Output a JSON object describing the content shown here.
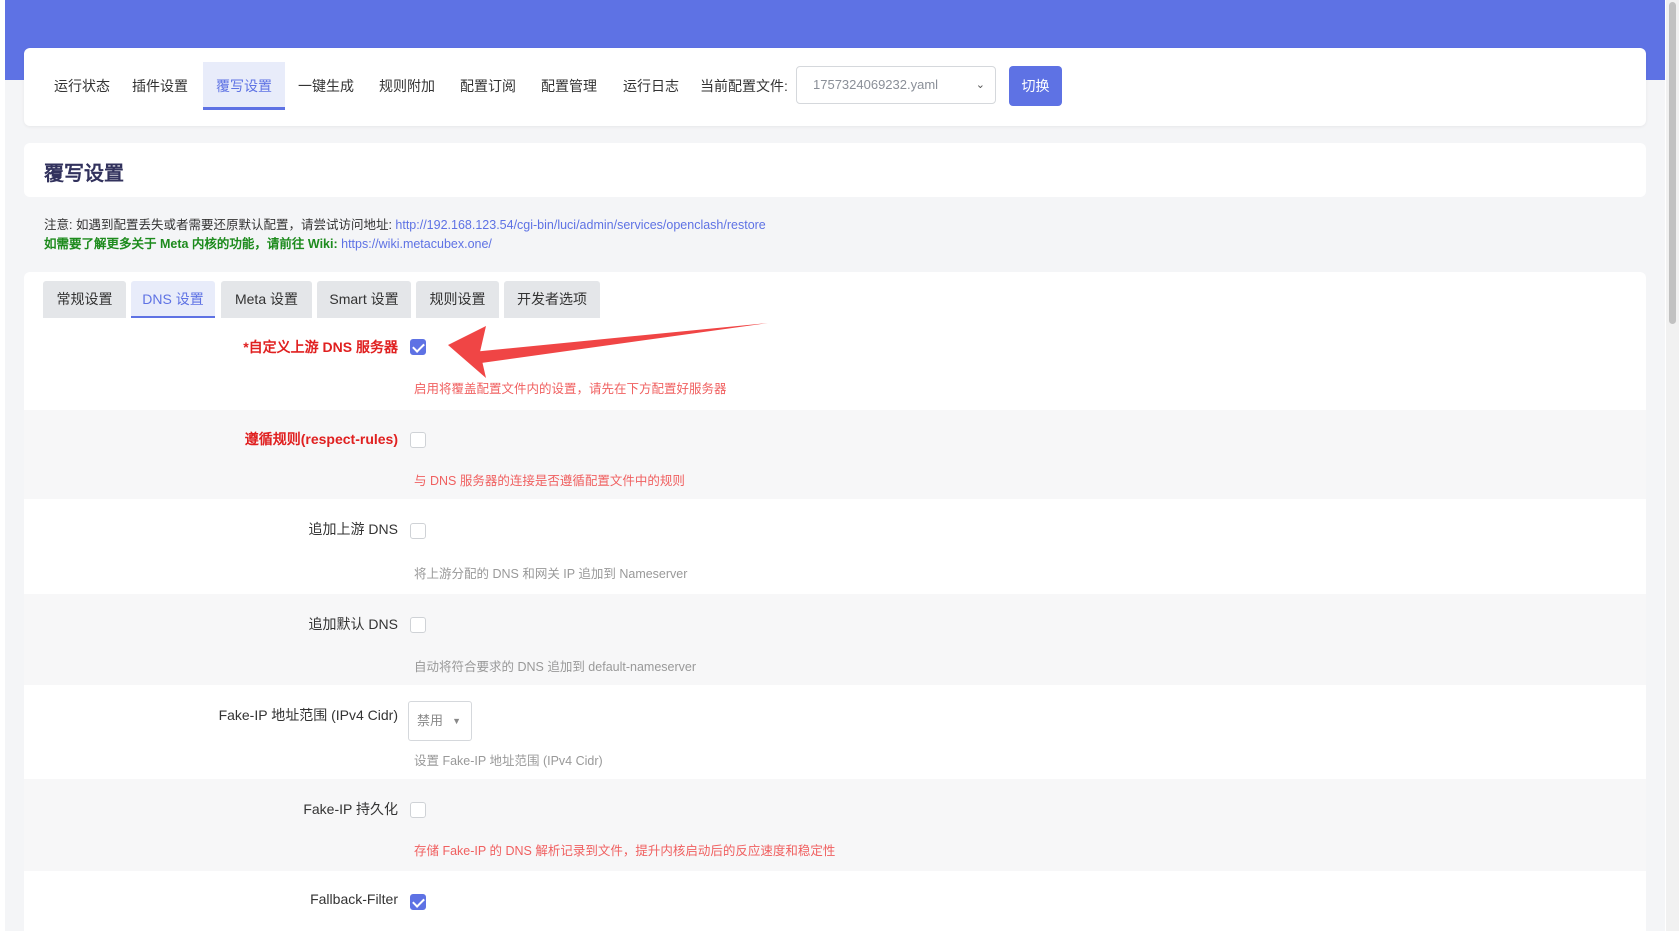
{
  "nav": {
    "items": [
      {
        "label": "运行状态"
      },
      {
        "label": "插件设置"
      },
      {
        "label": "覆写设置"
      },
      {
        "label": "一键生成"
      },
      {
        "label": "规则附加"
      },
      {
        "label": "配置订阅"
      },
      {
        "label": "配置管理"
      },
      {
        "label": "运行日志"
      }
    ],
    "active_index": 2,
    "config_label": "当前配置文件:",
    "config_value": "1757324069232.yaml",
    "switch_label": "切换"
  },
  "page_title": "覆写设置",
  "notes": {
    "line1_text": "注意: 如遇到配置丢失或者需要还原默认配置，请尝试访问地址: ",
    "line1_link": "http://192.168.123.54/cgi-bin/luci/admin/services/openclash/restore",
    "line2_text": "如需要了解更多关于 Meta 内核的功能，请前往 Wiki: ",
    "line2_link": "https://wiki.metacubex.one/"
  },
  "tabs": [
    {
      "label": "常规设置"
    },
    {
      "label": "DNS 设置"
    },
    {
      "label": "Meta 设置"
    },
    {
      "label": "Smart 设置"
    },
    {
      "label": "规则设置"
    },
    {
      "label": "开发者选项"
    }
  ],
  "active_tab_index": 1,
  "settings": [
    {
      "label": "*自定义上游 DNS 服务器",
      "checked": true,
      "description": "启用将覆盖配置文件内的设置，请先在下方配置好服务器"
    },
    {
      "label": "遵循规则(respect-rules)",
      "checked": false,
      "description": "与 DNS 服务器的连接是否遵循配置文件中的规则"
    },
    {
      "label": "追加上游 DNS",
      "checked": false,
      "description": "将上游分配的 DNS 和网关 IP 追加到 Nameserver"
    },
    {
      "label": "追加默认 DNS",
      "checked": false,
      "description": "自动将符合要求的 DNS 追加到 default-nameserver"
    },
    {
      "label": "Fake-IP 地址范围 (IPv4 Cidr)",
      "select_value": "禁用",
      "description": "设置 Fake-IP 地址范围 (IPv4 Cidr)"
    },
    {
      "label": "Fake-IP 持久化",
      "checked": false,
      "description": "存储 Fake-IP 的 DNS 解析记录到文件，提升内核启动后的反应速度和稳定性"
    },
    {
      "label": "Fallback-Filter",
      "checked": true
    }
  ],
  "colors": {
    "accent": "#5e72e4",
    "required_red": "#e02020",
    "hint_red": "#f06060",
    "annotation_arrow": "#f04545"
  }
}
